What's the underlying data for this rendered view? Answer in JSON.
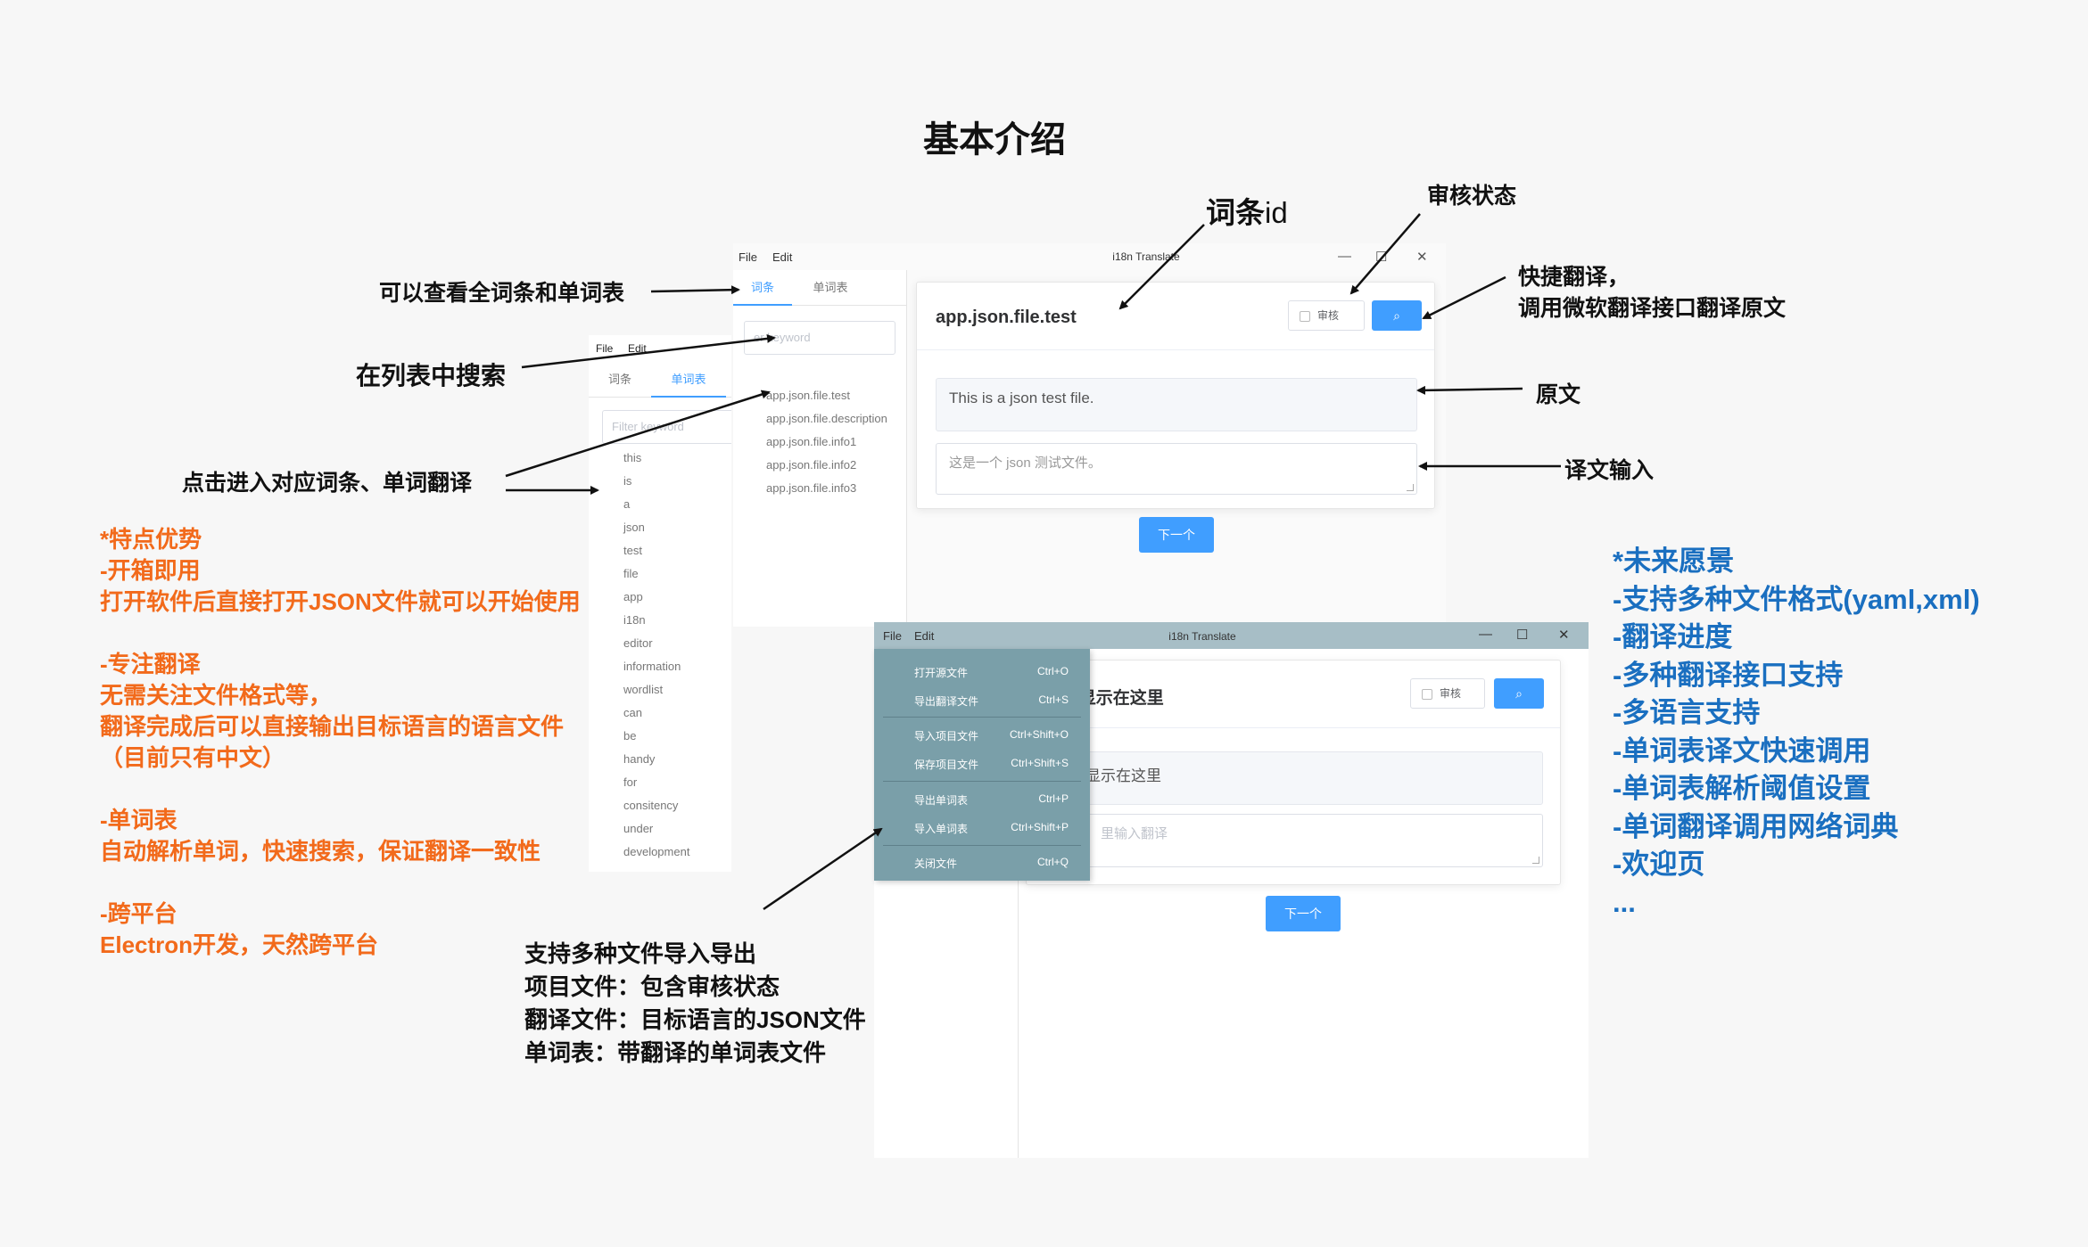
{
  "heading": "基本介绍",
  "window1": {
    "menu_file": "File",
    "menu_edit": "Edit",
    "app_title": "i18n Translate",
    "tabs": [
      "词条",
      "单词表"
    ],
    "filter_placeholder": "er keyword",
    "entries": [
      "app.json.file.test",
      "app.json.file.description",
      "app.json.file.info1",
      "app.json.file.info2",
      "app.json.file.info3"
    ],
    "entry_id": "app.json.file.test",
    "review_label": "审核",
    "source_text": "This is a json test file.",
    "target_text": "这是一个 json 测试文件。",
    "next_button": "下一个"
  },
  "window_word": {
    "menu_file": "File",
    "menu_edit": "Edit",
    "tabs": [
      "词条",
      "单词表"
    ],
    "filter_placeholder": "Filter keyword",
    "words": [
      "this",
      "is",
      "a",
      "json",
      "test",
      "file",
      "app",
      "i18n",
      "editor",
      "information",
      "wordlist",
      "can",
      "be",
      "handy",
      "for",
      "consitency",
      "under",
      "development"
    ]
  },
  "window2": {
    "menu_file": "File",
    "menu_edit": "Edit",
    "app_title": "i18n Translate",
    "entry_id_partial": "D显示在这里",
    "review_label": "审核",
    "source_partial": "显示在这里",
    "target_placeholder_partial": "里输入翻译",
    "next_button": "下一个",
    "file_menu": [
      {
        "label": "打开源文件",
        "shortcut": "Ctrl+O"
      },
      {
        "label": "导出翻译文件",
        "shortcut": "Ctrl+S"
      },
      {
        "label": "导入项目文件",
        "shortcut": "Ctrl+Shift+O"
      },
      {
        "label": "保存项目文件",
        "shortcut": "Ctrl+Shift+S"
      },
      {
        "label": "导出单词表",
        "shortcut": "Ctrl+P"
      },
      {
        "label": "导入单词表",
        "shortcut": "Ctrl+Shift+P"
      },
      {
        "label": "关闭文件",
        "shortcut": "Ctrl+Q"
      }
    ]
  },
  "annotations": {
    "entry_id_label": "词条",
    "entry_id_suffix": "id",
    "review_status": "审核状态",
    "view_all": "可以查看全词条和单词表",
    "quick_translate_1": "快捷翻译，",
    "quick_translate_2": "调用微软翻译接口翻译原文",
    "search": "在列表中搜索",
    "source": "原文",
    "click_enter": "点击进入对应词条、单词翻译",
    "translation_input": "译文输入",
    "import_export": [
      "支持多种文件导入导出",
      "项目文件：包含审核状态",
      "翻译文件：目标语言的JSON文件",
      "单词表：带翻译的单词表文件"
    ]
  },
  "features": [
    "*特点优势",
    "-开箱即用",
    "打开软件后直接打开JSON文件就可以开始使用",
    "",
    "-专注翻译",
    "无需关注文件格式等，",
    "翻译完成后可以直接输出目标语言的语言文件",
    "（目前只有中文）",
    "",
    "-单词表",
    "自动解析单词，快速搜索，保证翻译一致性",
    "",
    "-跨平台",
    "Electron开发，天然跨平台"
  ],
  "future": [
    "*未来愿景",
    "-支持多种文件格式(yaml,xml)",
    "-翻译进度",
    "-多种翻译接口支持",
    "-多语言支持",
    "-单词表译文快速调用",
    "-单词表解析阈值设置",
    "-单词翻译调用网络词典",
    "-欢迎页",
    "..."
  ],
  "colors": {
    "accent_blue": "#409eff",
    "features_orange": "#f26a1b",
    "future_blue": "#1a6fc0",
    "menu_bg": "#7a9fa9"
  }
}
